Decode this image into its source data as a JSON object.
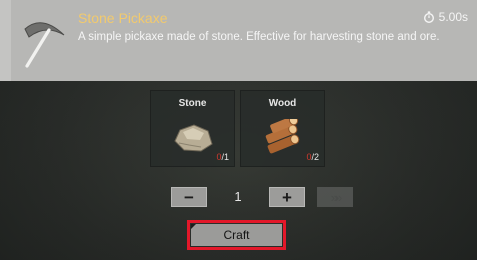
{
  "recipe": {
    "title": "Stone Pickaxe",
    "description": "A simple pickaxe made of stone. Effective for harvesting stone and ore.",
    "craft_time": "5.00s",
    "icon": "pickaxe-icon"
  },
  "ingredients": [
    {
      "name": "Stone",
      "have": "0",
      "need": "/1",
      "icon": "stone-icon"
    },
    {
      "name": "Wood",
      "have": "0",
      "need": "/2",
      "icon": "wood-logs-icon"
    }
  ],
  "quantity": {
    "value": "1",
    "minus": "−",
    "plus": "+",
    "max": "»»"
  },
  "craft": {
    "label": "Craft"
  },
  "colors": {
    "title": "#f2ca6d",
    "missing": "#d23a2f",
    "highlight": "#e3182a"
  }
}
